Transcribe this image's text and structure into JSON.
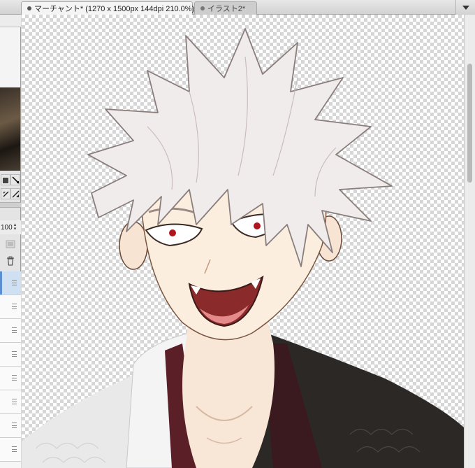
{
  "tabs": [
    {
      "label": "マーチャント* (1270 x 1500px 144dpi 210.0%)",
      "active": true
    },
    {
      "label": "イラスト2*",
      "active": false
    }
  ],
  "layer_panel": {
    "opacity_value": "100"
  },
  "icons": {
    "tab_dot": "document-dot-icon",
    "tab_menu": "chevron-down-icon",
    "trash": "trash-icon",
    "layer_handle": "drag-handle-icon"
  },
  "colors": {
    "selection_blue": "#cfe0f3",
    "hair": "#f1ecec",
    "skin": "#fbeede",
    "eyes": "#b0141c",
    "kimono_dark": "#2b2826"
  }
}
